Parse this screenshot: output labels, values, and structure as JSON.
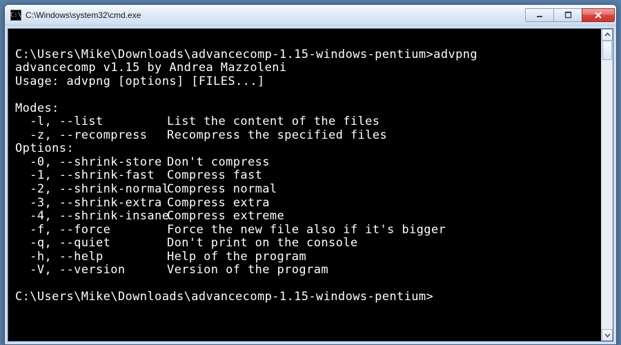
{
  "window": {
    "title": "C:\\Windows\\system32\\cmd.exe",
    "icon_label": "C:\\"
  },
  "buttons": {
    "minimize": "Minimize",
    "maximize": "Maximize",
    "close": "Close"
  },
  "console": {
    "prompt1": "C:\\Users\\Mike\\Downloads\\advancecomp-1.15-windows-pentium>advpng",
    "banner": "advancecomp v1.15 by Andrea Mazzoleni",
    "usage": "Usage: advpng [options] [FILES...]",
    "modes_header": "Modes:",
    "modes": [
      {
        "flag": "  -l, --list",
        "desc": "List the content of the files"
      },
      {
        "flag": "  -z, --recompress",
        "desc": "Recompress the specified files"
      }
    ],
    "options_header": "Options:",
    "options": [
      {
        "flag": "  -0, --shrink-store",
        "desc": "Don't compress"
      },
      {
        "flag": "  -1, --shrink-fast",
        "desc": "Compress fast"
      },
      {
        "flag": "  -2, --shrink-normal",
        "desc": "Compress normal"
      },
      {
        "flag": "  -3, --shrink-extra",
        "desc": "Compress extra"
      },
      {
        "flag": "  -4, --shrink-insane",
        "desc": "Compress extreme"
      },
      {
        "flag": "  -f, --force",
        "desc": "Force the new file also if it's bigger"
      },
      {
        "flag": "  -q, --quiet",
        "desc": "Don't print on the console"
      },
      {
        "flag": "  -h, --help",
        "desc": "Help of the program"
      },
      {
        "flag": "  -V, --version",
        "desc": "Version of the program"
      }
    ],
    "prompt2": "C:\\Users\\Mike\\Downloads\\advancecomp-1.15-windows-pentium>"
  },
  "scrollbar": {
    "up": "Scroll up",
    "down": "Scroll down"
  }
}
